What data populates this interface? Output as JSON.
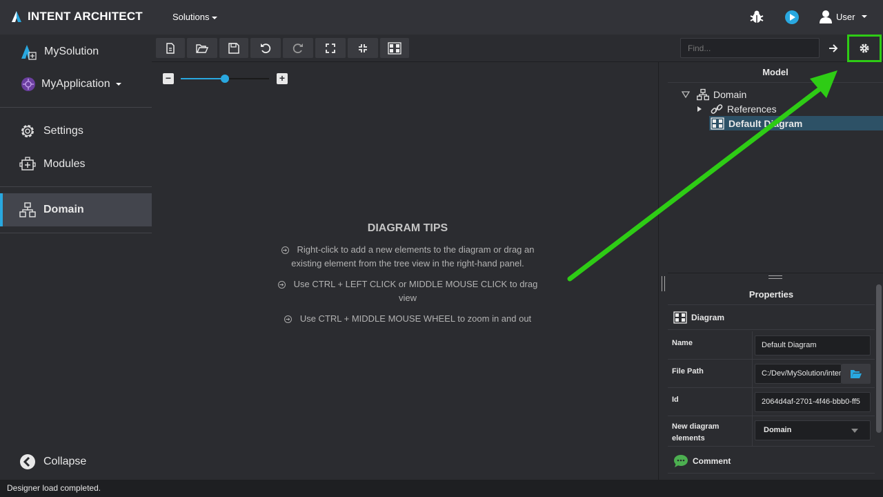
{
  "app": {
    "name": "INTENT ARCHITECT"
  },
  "topbar": {
    "solutions_label": "Solutions",
    "user_label": "User"
  },
  "sidebar": {
    "solution": "MySolution",
    "application": "MyApplication",
    "items": [
      {
        "label": "Settings",
        "icon": "gear-icon"
      },
      {
        "label": "Modules",
        "icon": "modules-icon"
      },
      {
        "label": "Domain",
        "icon": "domain-icon",
        "active": true
      }
    ],
    "collapse_label": "Collapse"
  },
  "toolbar": {
    "find_placeholder": "Find..."
  },
  "zoom": {
    "level": 0.5
  },
  "tips": {
    "title": "DIAGRAM TIPS",
    "items": [
      "Right-click to add a new elements to the diagram or drag an existing element from the tree view in the right-hand panel.",
      "Use CTRL + LEFT CLICK or MIDDLE MOUSE CLICK to drag view",
      "Use CTRL + MIDDLE MOUSE WHEEL to zoom in and out"
    ]
  },
  "model": {
    "title": "Model",
    "tree": {
      "root": "Domain",
      "children": [
        "References",
        "Default Diagram"
      ]
    }
  },
  "properties": {
    "title": "Properties",
    "section": "Diagram",
    "rows": [
      {
        "label": "Name",
        "value": "Default Diagram"
      },
      {
        "label": "File Path",
        "value": "C:/Dev/MySolution/intent"
      },
      {
        "label": "Id",
        "value": "2064d4af-2701-4f46-bbb0-ff5"
      },
      {
        "label": "New diagram elements",
        "value": "Domain"
      }
    ],
    "comment_label": "Comment"
  },
  "status": {
    "text": "Designer load completed."
  },
  "colors": {
    "accent": "#29a8e0",
    "highlight": "#2ecc15",
    "selected": "#2d5166"
  }
}
